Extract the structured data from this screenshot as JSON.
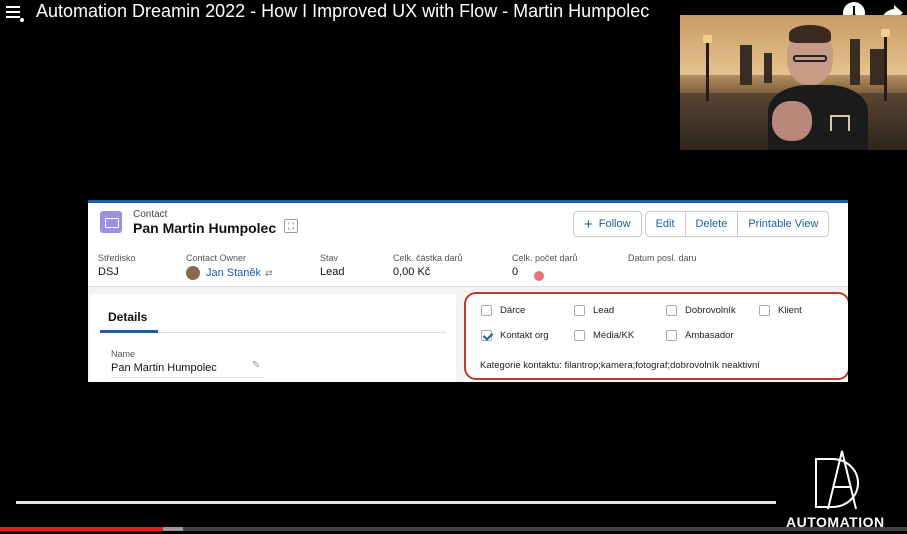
{
  "video": {
    "title": "Automation Dreamin 2022 - How I Improved UX with Flow - Martin Humpolec",
    "icons": [
      "playlist-icon",
      "watch-later-icon",
      "share-icon"
    ],
    "progress_fraction": 0.18
  },
  "record": {
    "object_label": "Contact",
    "name": "Pan Martin Humpolec",
    "hierarchy_icon": "⛶",
    "buttons": {
      "follow": "Follow",
      "edit": "Edit",
      "delete": "Delete",
      "printable": "Printable View"
    },
    "fields": [
      {
        "label": "Středisko",
        "value": "DSJ"
      },
      {
        "label": "Contact Owner",
        "value": "Jan Staněk"
      },
      {
        "label": "Stav",
        "value": "Lead"
      },
      {
        "label": "Celk. částka darů",
        "value": "0,00 Kč"
      },
      {
        "label": "Celk. počet darů",
        "value": "0"
      },
      {
        "label": "Datum posl. daru",
        "value": ""
      }
    ]
  },
  "details": {
    "tab_label": "Details",
    "name_label": "Name",
    "name_value": "Pan Martin Humpolec"
  },
  "checkboxes": [
    {
      "label": "Dárce",
      "checked": false
    },
    {
      "label": "Lead",
      "checked": false
    },
    {
      "label": "Dobrovolník",
      "checked": false
    },
    {
      "label": "Klient",
      "checked": false
    },
    {
      "label": "Kontakt org",
      "checked": true
    },
    {
      "label": "Média/KK",
      "checked": false
    },
    {
      "label": "Ambasador",
      "checked": false
    }
  ],
  "kategorie_text": "Kategorie kontaktu: filantrop;kamera;fotograf;dobrovolník neaktivní",
  "logo": {
    "text": "AUTOMATION"
  },
  "colors": {
    "sf_blue": "#1b5fa7",
    "highlight_red": "#c0392b",
    "contact_icon": "#9b8fe8",
    "yt_progress": "#e01b1b"
  }
}
